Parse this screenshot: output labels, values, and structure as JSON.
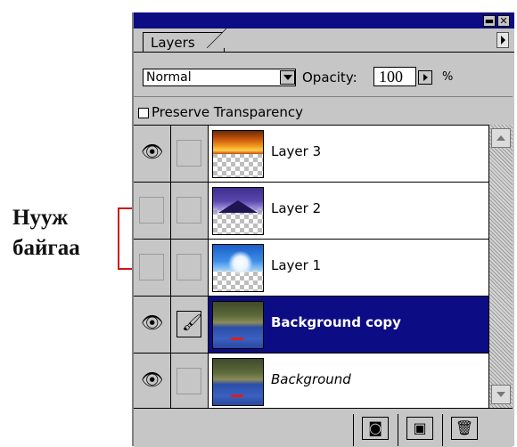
{
  "annotation": {
    "label_line1": "Нууж",
    "label_line2": "байгаа",
    "color": "#d21414"
  },
  "window": {
    "minimize_glyph": "▬",
    "close_glyph": "✕"
  },
  "tab": {
    "label": "Layers"
  },
  "controls": {
    "blend_mode": "Normal",
    "opacity_label": "Opacity:",
    "opacity_value": "100",
    "percent": "%",
    "preserve_transparency_label": "Preserve Transparency"
  },
  "layers": [
    {
      "name": "Layer 3",
      "visible": true,
      "brush": false,
      "selected": false,
      "thumb": "sunset-icon"
    },
    {
      "name": "Layer 2",
      "visible": false,
      "brush": false,
      "selected": false,
      "thumb": "mountain-icon"
    },
    {
      "name": "Layer 1",
      "visible": false,
      "brush": false,
      "selected": false,
      "thumb": "sky-icon"
    },
    {
      "name": "Background copy",
      "visible": true,
      "brush": true,
      "selected": true,
      "thumb": "landscape-icon"
    },
    {
      "name": "Background",
      "visible": true,
      "brush": false,
      "selected": false,
      "thumb": "landscape-icon"
    }
  ],
  "icons": {
    "eye": "👁",
    "brush": "🖌",
    "mask": "◙",
    "new_layer": "▣",
    "trash": "🗑"
  },
  "colors": {
    "titlebar": "#0c0c84",
    "selection": "#0c0c84",
    "panel": "#c6c6c6"
  }
}
